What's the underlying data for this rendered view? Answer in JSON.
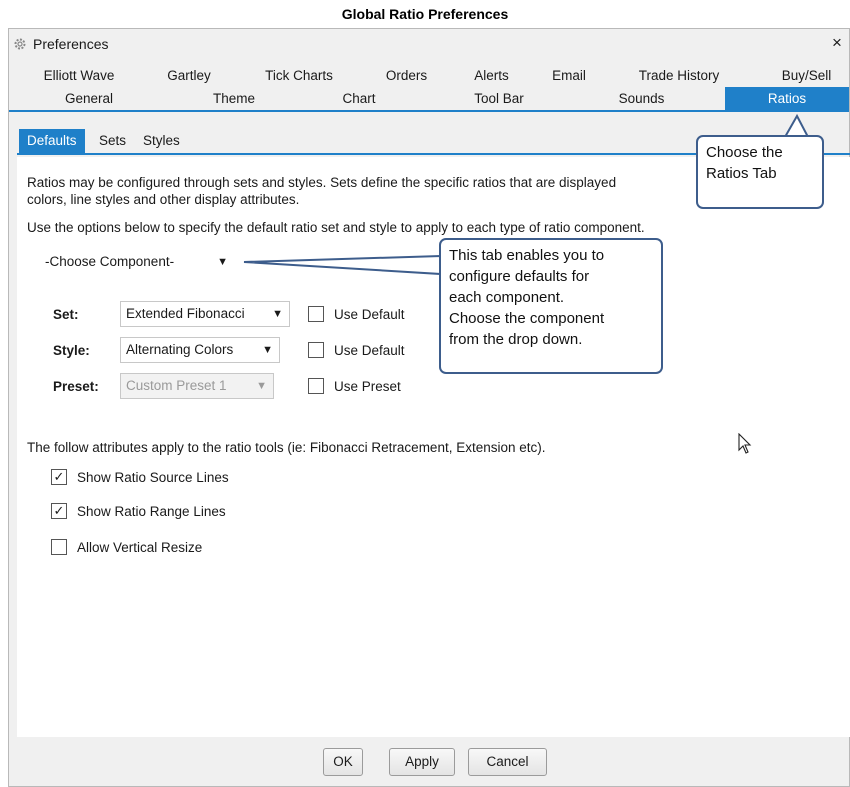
{
  "caption": "Global Ratio Preferences",
  "window": {
    "title": "Preferences",
    "close_label": "×"
  },
  "tabs_row1": [
    "Elliott Wave",
    "Gartley",
    "Tick Charts",
    "Orders",
    "Alerts",
    "Email",
    "Trade History",
    "Buy/Sell"
  ],
  "tabs_row2": [
    "General",
    "Theme",
    "Chart",
    "Tool Bar",
    "Sounds",
    "Ratios"
  ],
  "active_tab": "Ratios",
  "subtabs": [
    "Defaults",
    "Sets",
    "Styles"
  ],
  "active_subtab": "Defaults",
  "content": {
    "intro_line1": "Ratios may be configured through sets and styles. Sets define the specific ratios that are displayed",
    "intro_line2": "colors, line styles and other display attributes.",
    "instruction": "Use the options below to specify the default ratio set and style to apply to each type of ratio component.",
    "component_dropdown": "-Choose Component-",
    "set": {
      "label": "Set:",
      "value": "Extended Fibonacci",
      "checkbox_label": "Use Default",
      "checked": false
    },
    "style": {
      "label": "Style:",
      "value": "Alternating Colors",
      "checkbox_label": "Use Default",
      "checked": false
    },
    "preset": {
      "label": "Preset:",
      "value": "Custom Preset 1",
      "checkbox_label": "Use Preset",
      "checked": false,
      "disabled": true
    },
    "attributes_note": "The follow attributes apply to the ratio tools (ie: Fibonacci Retracement, Extension etc).",
    "options": [
      {
        "label": "Show Ratio Source Lines",
        "checked": true
      },
      {
        "label": "Show Ratio Range Lines",
        "checked": true
      },
      {
        "label": "Allow Vertical Resize",
        "checked": false
      }
    ]
  },
  "buttons": {
    "ok": "OK",
    "apply": "Apply",
    "cancel": "Cancel"
  },
  "callouts": {
    "ratios_tab": [
      "Choose the",
      "Ratios Tab"
    ],
    "component": [
      "This tab enables you to",
      "configure defaults for",
      "each component.",
      "Choose the component",
      "from the drop down."
    ]
  },
  "colors": {
    "accent": "#1f80c9",
    "callout_border": "#3d5d8c"
  },
  "icons": {
    "window": "gear-icon",
    "pointer": "mouse-cursor-icon",
    "dropdown": "triangle-down-icon",
    "check": "checkmark-icon"
  }
}
